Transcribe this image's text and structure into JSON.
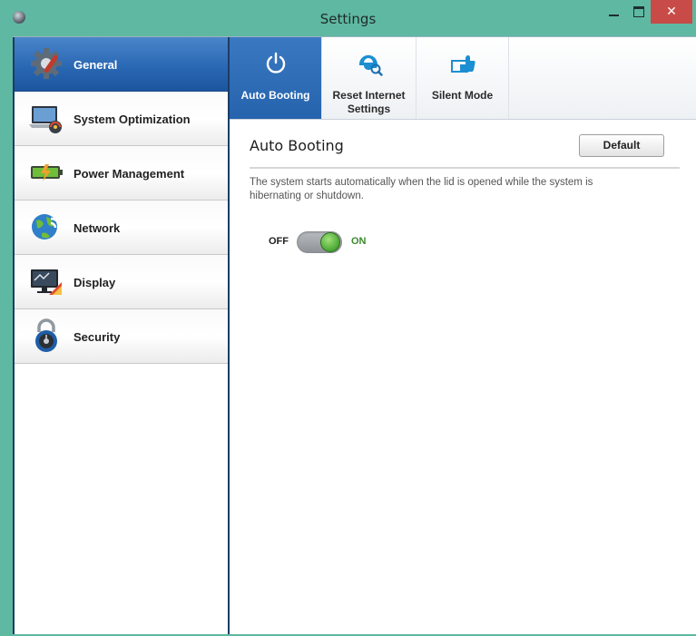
{
  "window": {
    "title": "Settings",
    "close_glyph": "✕"
  },
  "sidebar": {
    "items": [
      {
        "label": "General",
        "icon": "gear-icon",
        "active": true
      },
      {
        "label": "System Optimization",
        "icon": "laptop-gauge-icon",
        "active": false
      },
      {
        "label": "Power Management",
        "icon": "battery-icon",
        "active": false
      },
      {
        "label": "Network",
        "icon": "globe-wifi-icon",
        "active": false
      },
      {
        "label": "Display",
        "icon": "monitor-icon",
        "active": false
      },
      {
        "label": "Security",
        "icon": "padlock-icon",
        "active": false
      }
    ]
  },
  "tabs": [
    {
      "label": "Auto Booting",
      "icon": "power-icon",
      "active": true
    },
    {
      "label": "Reset Internet Settings",
      "icon": "internet-explorer-icon",
      "active": false
    },
    {
      "label": "Silent Mode",
      "icon": "silent-mode-icon",
      "active": false
    }
  ],
  "content": {
    "title": "Auto Booting",
    "default_button": "Default",
    "description": "The system starts automatically when the lid is opened while the system is hibernating or shutdown.",
    "toggle": {
      "off_label": "OFF",
      "on_label": "ON",
      "state": "on"
    }
  },
  "colors": {
    "titlebar": "#5fb8a2",
    "active_item": "#2a68b4",
    "close_button": "#c94b47",
    "toggle_on": "#4aa833"
  }
}
